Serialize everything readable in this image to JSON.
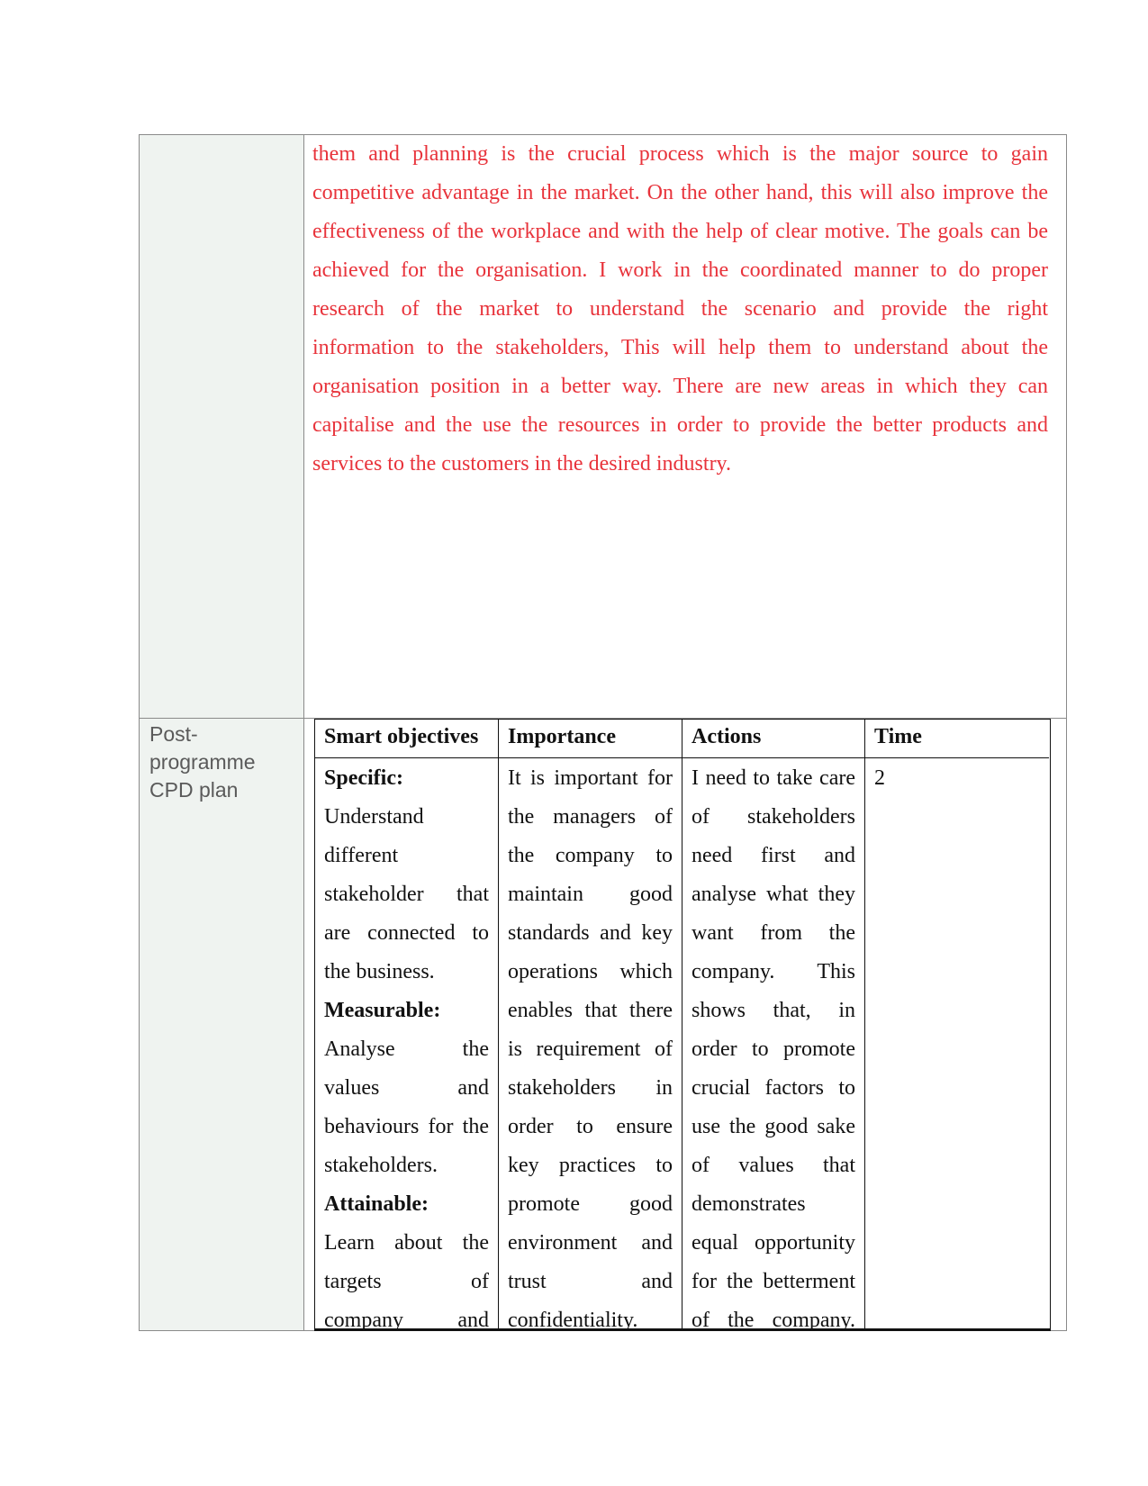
{
  "document": {
    "paragraph_lines": [
      "them and planning is the crucial process which is the major source to gain",
      "competitive advantage in the market. On the other hand, this will also improve the",
      "effectiveness of the workplace and with the help of clear motive. The goals can be",
      "achieved for the organisation. I work in the coordinated manner to do proper",
      "research of the market to understand the scenario and provide the right",
      "information to the stakeholders, This will help them to understand about the",
      "organisation position in a better way. There are new areas in which they can",
      "capitalise and the use the resources in order to provide the better products and",
      "services to the customers in the desired industry."
    ],
    "text_color": "#e8333b",
    "row_label": [
      "Post-",
      "programme",
      "CPD plan"
    ],
    "plan_table": {
      "headers": [
        "Smart objectives",
        "Importance",
        "Actions",
        "Time"
      ],
      "columns": [
        {
          "lines": [
            {
              "text": "Specific:",
              "bold": true
            },
            {
              "text": "Understand",
              "left": true
            },
            {
              "text": "different",
              "left": true
            },
            {
              "text": "stakeholder that"
            },
            {
              "text": "are connected to"
            },
            {
              "text": "the business.",
              "left": true
            },
            {
              "text": "Measurable:",
              "bold": true
            },
            {
              "text": "Analyse the"
            },
            {
              "text": "values and"
            },
            {
              "text": "behaviours for the"
            },
            {
              "text": "stakeholders.",
              "left": true
            },
            {
              "text": "Attainable:",
              "bold": true
            },
            {
              "text": "Learn about the"
            },
            {
              "text": "targets of"
            },
            {
              "text": "company and"
            }
          ]
        },
        {
          "lines": [
            {
              "text": "It is important for"
            },
            {
              "text": "the managers of"
            },
            {
              "text": "the company to"
            },
            {
              "text": "maintain good"
            },
            {
              "text": "standards and key"
            },
            {
              "text": "operations which"
            },
            {
              "text": "enables that there"
            },
            {
              "text": "is requirement of"
            },
            {
              "text": "stakeholders in"
            },
            {
              "text": "order to ensure"
            },
            {
              "text": "key practices to"
            },
            {
              "text": "promote good"
            },
            {
              "text": "environment and"
            },
            {
              "text": "trust and"
            },
            {
              "text": "confidentiality.",
              "left": true
            }
          ]
        },
        {
          "lines": [
            {
              "text": "I need to take care"
            },
            {
              "text": "of stakeholders"
            },
            {
              "text": "need first and"
            },
            {
              "text": "analyse what they"
            },
            {
              "text": "want from the"
            },
            {
              "text": "company. This"
            },
            {
              "text": "shows that, in"
            },
            {
              "text": "order to promote"
            },
            {
              "text": "crucial factors to"
            },
            {
              "text": "use the good sake"
            },
            {
              "text": "of values that"
            },
            {
              "text": "demonstrates",
              "left": true
            },
            {
              "text": "equal opportunity"
            },
            {
              "text": "for the betterment"
            },
            {
              "text": "of the company."
            }
          ]
        },
        {
          "lines": [
            {
              "text": "2",
              "left": true
            }
          ]
        }
      ]
    }
  }
}
